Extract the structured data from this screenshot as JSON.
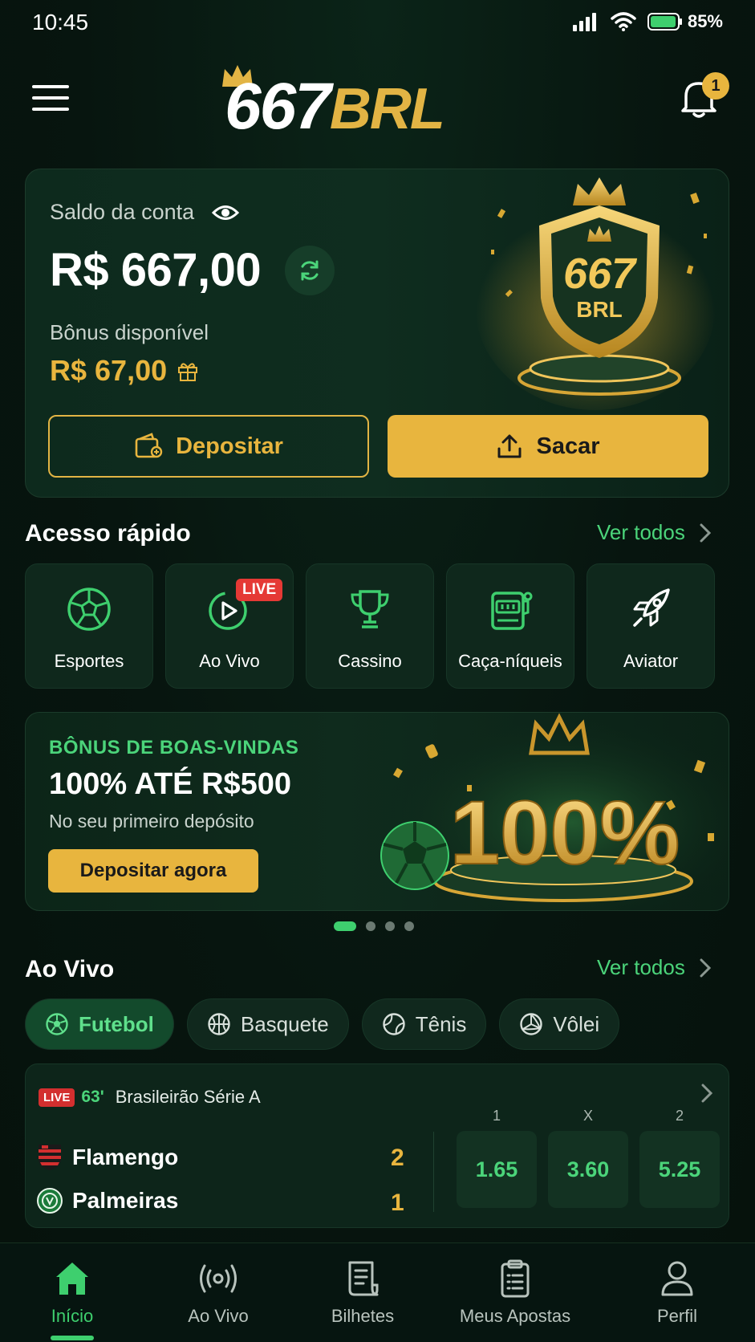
{
  "status_bar": {
    "time": "10:45",
    "battery": "85%"
  },
  "header": {
    "logo_number": "667",
    "logo_suffix": "BRL",
    "notification_count": "1"
  },
  "balance": {
    "label": "Saldo da conta",
    "amount": "R$ 667,00",
    "bonus_label": "Bônus disponível",
    "bonus_amount": "R$ 67,00",
    "deposit_label": "Depositar",
    "withdraw_label": "Sacar",
    "shield_number": "667",
    "shield_suffix": "BRL"
  },
  "quick_access": {
    "title": "Acesso rápido",
    "see_all": "Ver todos",
    "items": [
      {
        "label": "Esportes",
        "icon": "soccer-ball-icon"
      },
      {
        "label": "Ao Vivo",
        "icon": "live-play-icon",
        "badge": "LIVE"
      },
      {
        "label": "Cassino",
        "icon": "trophy-icon"
      },
      {
        "label": "Caça-níqueis",
        "icon": "slot-machine-icon"
      },
      {
        "label": "Aviator",
        "icon": "rocket-icon"
      }
    ]
  },
  "promo": {
    "eyebrow": "BÔNUS DE BOAS-VINDAS",
    "title": "100% ATÉ R$500",
    "subtitle": "No seu primeiro depósito",
    "button": "Depositar agora",
    "art_text": "100%",
    "active_slide": 1,
    "slide_count": 4
  },
  "live": {
    "title": "Ao Vivo",
    "see_all": "Ver todos",
    "filters": [
      {
        "label": "Futebol",
        "icon": "soccer-ball-icon",
        "active": true
      },
      {
        "label": "Basquete",
        "icon": "basketball-icon",
        "active": false
      },
      {
        "label": "Tênis",
        "icon": "tennis-ball-icon",
        "active": false
      },
      {
        "label": "Vôlei",
        "icon": "volleyball-icon",
        "active": false
      }
    ],
    "match": {
      "live_tag": "LIVE",
      "minute": "63'",
      "league": "Brasileirão Série A",
      "home_team": "Flamengo",
      "away_team": "Palmeiras",
      "home_score": "2",
      "away_score": "1",
      "odds_headers": [
        "1",
        "X",
        "2"
      ],
      "odds": [
        "1.65",
        "3.60",
        "5.25"
      ]
    }
  },
  "bottom_nav": [
    {
      "label": "Início",
      "icon": "home-icon",
      "active": true
    },
    {
      "label": "Ao Vivo",
      "icon": "broadcast-icon",
      "active": false
    },
    {
      "label": "Bilhetes",
      "icon": "ticket-icon",
      "active": false
    },
    {
      "label": "Meus Apostas",
      "icon": "clipboard-icon",
      "active": false
    },
    {
      "label": "Perfil",
      "icon": "user-icon",
      "active": false
    }
  ],
  "colors": {
    "gold": "#e8b53e",
    "green": "#4bd47a",
    "background": "#06140e"
  }
}
